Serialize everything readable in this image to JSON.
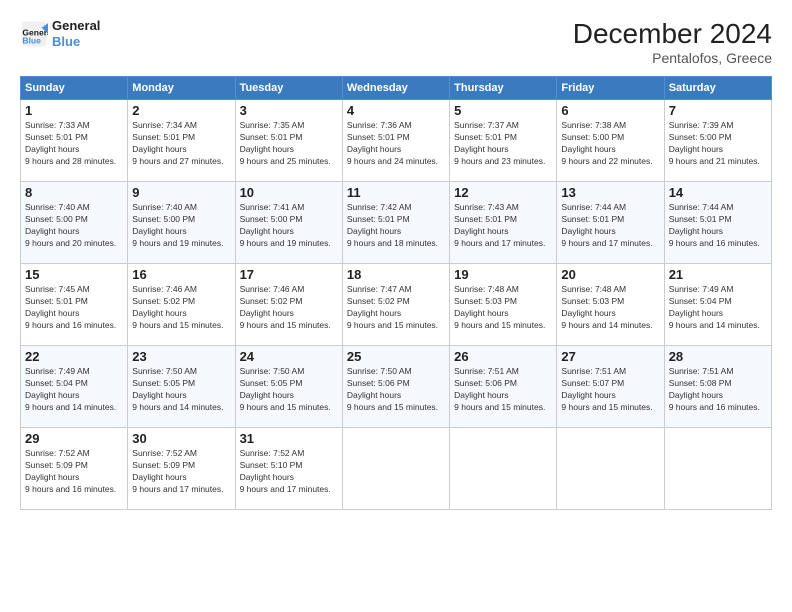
{
  "header": {
    "logo_line1": "General",
    "logo_line2": "Blue",
    "month_year": "December 2024",
    "location": "Pentalofos, Greece"
  },
  "days_of_week": [
    "Sunday",
    "Monday",
    "Tuesday",
    "Wednesday",
    "Thursday",
    "Friday",
    "Saturday"
  ],
  "weeks": [
    [
      {
        "num": "1",
        "sunrise": "7:33 AM",
        "sunset": "5:01 PM",
        "daylight": "9 hours and 28 minutes."
      },
      {
        "num": "2",
        "sunrise": "7:34 AM",
        "sunset": "5:01 PM",
        "daylight": "9 hours and 27 minutes."
      },
      {
        "num": "3",
        "sunrise": "7:35 AM",
        "sunset": "5:01 PM",
        "daylight": "9 hours and 25 minutes."
      },
      {
        "num": "4",
        "sunrise": "7:36 AM",
        "sunset": "5:01 PM",
        "daylight": "9 hours and 24 minutes."
      },
      {
        "num": "5",
        "sunrise": "7:37 AM",
        "sunset": "5:01 PM",
        "daylight": "9 hours and 23 minutes."
      },
      {
        "num": "6",
        "sunrise": "7:38 AM",
        "sunset": "5:00 PM",
        "daylight": "9 hours and 22 minutes."
      },
      {
        "num": "7",
        "sunrise": "7:39 AM",
        "sunset": "5:00 PM",
        "daylight": "9 hours and 21 minutes."
      }
    ],
    [
      {
        "num": "8",
        "sunrise": "7:40 AM",
        "sunset": "5:00 PM",
        "daylight": "9 hours and 20 minutes."
      },
      {
        "num": "9",
        "sunrise": "7:40 AM",
        "sunset": "5:00 PM",
        "daylight": "9 hours and 19 minutes."
      },
      {
        "num": "10",
        "sunrise": "7:41 AM",
        "sunset": "5:00 PM",
        "daylight": "9 hours and 19 minutes."
      },
      {
        "num": "11",
        "sunrise": "7:42 AM",
        "sunset": "5:01 PM",
        "daylight": "9 hours and 18 minutes."
      },
      {
        "num": "12",
        "sunrise": "7:43 AM",
        "sunset": "5:01 PM",
        "daylight": "9 hours and 17 minutes."
      },
      {
        "num": "13",
        "sunrise": "7:44 AM",
        "sunset": "5:01 PM",
        "daylight": "9 hours and 17 minutes."
      },
      {
        "num": "14",
        "sunrise": "7:44 AM",
        "sunset": "5:01 PM",
        "daylight": "9 hours and 16 minutes."
      }
    ],
    [
      {
        "num": "15",
        "sunrise": "7:45 AM",
        "sunset": "5:01 PM",
        "daylight": "9 hours and 16 minutes."
      },
      {
        "num": "16",
        "sunrise": "7:46 AM",
        "sunset": "5:02 PM",
        "daylight": "9 hours and 15 minutes."
      },
      {
        "num": "17",
        "sunrise": "7:46 AM",
        "sunset": "5:02 PM",
        "daylight": "9 hours and 15 minutes."
      },
      {
        "num": "18",
        "sunrise": "7:47 AM",
        "sunset": "5:02 PM",
        "daylight": "9 hours and 15 minutes."
      },
      {
        "num": "19",
        "sunrise": "7:48 AM",
        "sunset": "5:03 PM",
        "daylight": "9 hours and 15 minutes."
      },
      {
        "num": "20",
        "sunrise": "7:48 AM",
        "sunset": "5:03 PM",
        "daylight": "9 hours and 14 minutes."
      },
      {
        "num": "21",
        "sunrise": "7:49 AM",
        "sunset": "5:04 PM",
        "daylight": "9 hours and 14 minutes."
      }
    ],
    [
      {
        "num": "22",
        "sunrise": "7:49 AM",
        "sunset": "5:04 PM",
        "daylight": "9 hours and 14 minutes."
      },
      {
        "num": "23",
        "sunrise": "7:50 AM",
        "sunset": "5:05 PM",
        "daylight": "9 hours and 14 minutes."
      },
      {
        "num": "24",
        "sunrise": "7:50 AM",
        "sunset": "5:05 PM",
        "daylight": "9 hours and 15 minutes."
      },
      {
        "num": "25",
        "sunrise": "7:50 AM",
        "sunset": "5:06 PM",
        "daylight": "9 hours and 15 minutes."
      },
      {
        "num": "26",
        "sunrise": "7:51 AM",
        "sunset": "5:06 PM",
        "daylight": "9 hours and 15 minutes."
      },
      {
        "num": "27",
        "sunrise": "7:51 AM",
        "sunset": "5:07 PM",
        "daylight": "9 hours and 15 minutes."
      },
      {
        "num": "28",
        "sunrise": "7:51 AM",
        "sunset": "5:08 PM",
        "daylight": "9 hours and 16 minutes."
      }
    ],
    [
      {
        "num": "29",
        "sunrise": "7:52 AM",
        "sunset": "5:09 PM",
        "daylight": "9 hours and 16 minutes."
      },
      {
        "num": "30",
        "sunrise": "7:52 AM",
        "sunset": "5:09 PM",
        "daylight": "9 hours and 17 minutes."
      },
      {
        "num": "31",
        "sunrise": "7:52 AM",
        "sunset": "5:10 PM",
        "daylight": "9 hours and 17 minutes."
      },
      null,
      null,
      null,
      null
    ]
  ],
  "labels": {
    "sunrise": "Sunrise:",
    "sunset": "Sunset:",
    "daylight": "Daylight hours"
  }
}
